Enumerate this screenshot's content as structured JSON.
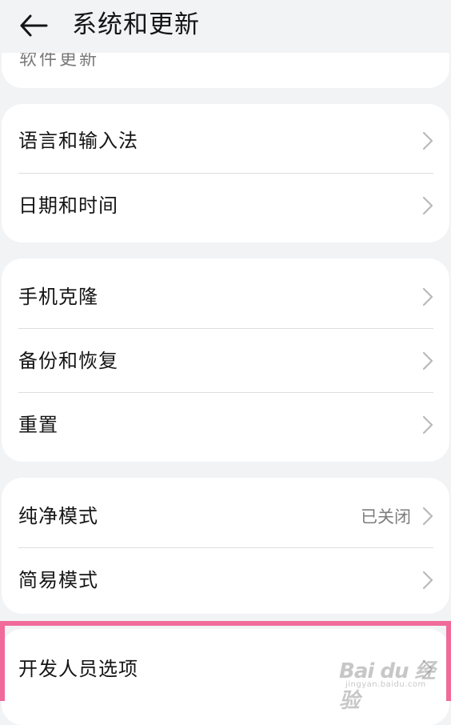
{
  "header": {
    "title": "系统和更新",
    "back_icon": "arrow-left-icon"
  },
  "clipped_item": {
    "label": "软件更新"
  },
  "groups": [
    {
      "items": [
        {
          "label": "语言和输入法"
        },
        {
          "label": "日期和时间"
        }
      ]
    },
    {
      "items": [
        {
          "label": "手机克隆"
        },
        {
          "label": "备份和恢复"
        },
        {
          "label": "重置"
        }
      ]
    },
    {
      "items": [
        {
          "label": "纯净模式",
          "status": "已关闭"
        },
        {
          "label": "简易模式"
        }
      ]
    },
    {
      "items": [
        {
          "label": "开发人员选项"
        }
      ]
    }
  ],
  "watermark": {
    "main": "Bai du 经验",
    "sub": "jingyan.baidu.com"
  },
  "colors": {
    "background": "#f1f3f5",
    "card": "#ffffff",
    "highlight": "#f06a9a"
  }
}
